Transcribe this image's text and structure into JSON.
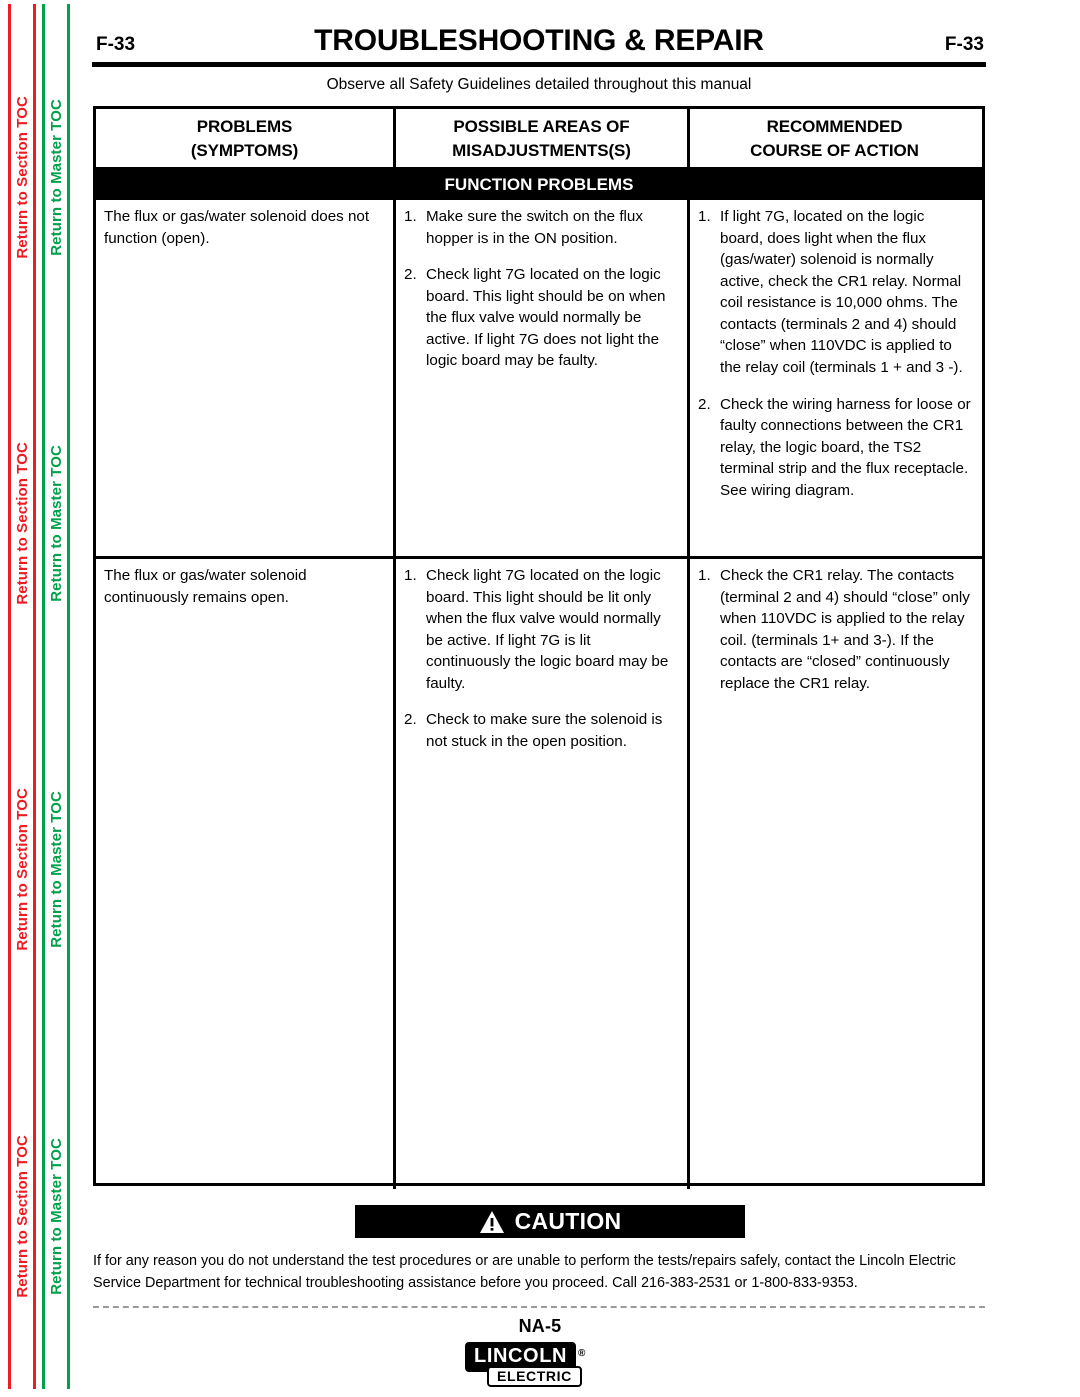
{
  "sidebar": {
    "section_toc_label": "Return to Section TOC",
    "master_toc_label": "Return to Master TOC",
    "repeat_count": 4,
    "section_color": "#ED1C24",
    "master_color": "#00A14B"
  },
  "header": {
    "folio_left": "F-33",
    "folio_right": "F-33",
    "title": "TROUBLESHOOTING & REPAIR",
    "safety_note": "Observe all Safety Guidelines detailed throughout this manual"
  },
  "table": {
    "columns": [
      {
        "line1": "PROBLEMS",
        "line2": "(SYMPTOMS)"
      },
      {
        "line1": "POSSIBLE AREAS OF",
        "line2": "MISADJUSTMENTS(S)"
      },
      {
        "line1": "RECOMMENDED",
        "line2": "COURSE OF ACTION"
      }
    ],
    "section_band": "FUNCTION PROBLEMS",
    "rows": [
      {
        "problem": "The flux or gas/water solenoid does not function (open).",
        "misadjustments": [
          {
            "num": "1.",
            "text": "Make sure the switch on the flux hopper is in the ON position."
          },
          {
            "num": "2.",
            "text": "Check light 7G located on the logic board.  This light should be on when the flux valve would normally be active.  If light 7G does not light the logic board may be faulty."
          }
        ],
        "actions": [
          {
            "num": "1.",
            "text": "If light 7G, located on the logic board, does light when the flux (gas/water) solenoid is normally active, check the CR1 relay.  Normal coil resistance is 10,000 ohms.  The contacts (terminals 2 and 4) should “close” when 110VDC is applied to the relay coil (terminals 1 + and 3 -)."
          },
          {
            "num": "2.",
            "text": "Check the wiring harness for loose or faulty connections between the CR1 relay, the logic board, the TS2 terminal strip and the flux receptacle.  See wiring diagram."
          }
        ]
      },
      {
        "problem": "The flux or gas/water solenoid continuously remains open.",
        "misadjustments": [
          {
            "num": "1.",
            "text": "Check light 7G located on the logic board.  This light should be lit only when the flux valve would normally be active.  If light 7G is lit continuously the logic board may be faulty."
          },
          {
            "num": "2.",
            "text": "Check to make sure the solenoid is not stuck in the open position."
          }
        ],
        "actions": [
          {
            "num": "1.",
            "text": "Check the CR1 relay.  The contacts (terminal 2 and 4) should “close” only when 110VDC is applied to the relay coil. (terminals 1+ and 3-).  If the contacts are “closed” continuously replace the CR1 relay."
          }
        ]
      }
    ]
  },
  "caution": {
    "label": "CAUTION",
    "body": "If for any reason you do not understand the test procedures or are unable to perform the tests/repairs safely, contact the Lincoln Electric Service Department for technical troubleshooting assistance before you proceed. Call 216-383-2531 or 1-800-833-9353."
  },
  "footer": {
    "model": "NA-5",
    "logo_top": "LINCOLN",
    "logo_registered": "®",
    "logo_bottom": "ELECTRIC"
  }
}
